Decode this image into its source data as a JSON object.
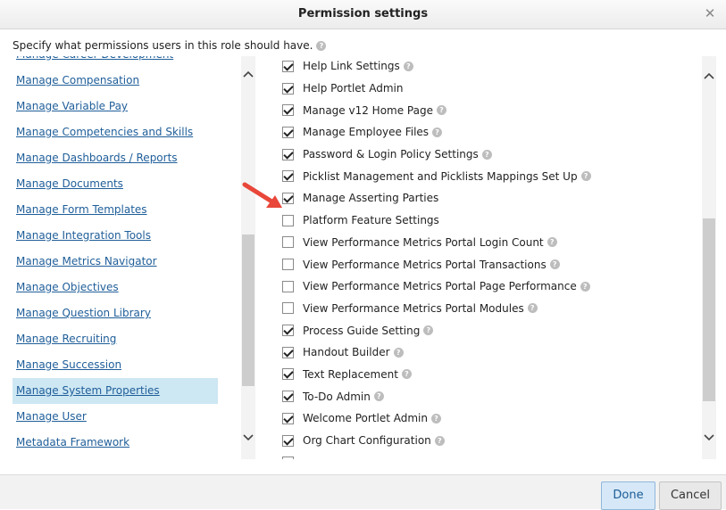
{
  "dialog": {
    "title": "Permission settings",
    "close_glyph": "✕",
    "instruction": "Specify what permissions users in this role should have.",
    "help_glyph": "?"
  },
  "left_list": {
    "items": [
      {
        "label": "Manage Career Development",
        "selected": false
      },
      {
        "label": "Manage Compensation",
        "selected": false
      },
      {
        "label": "Manage Variable Pay",
        "selected": false
      },
      {
        "label": "Manage Competencies and Skills",
        "selected": false
      },
      {
        "label": "Manage Dashboards / Reports",
        "selected": false
      },
      {
        "label": "Manage Documents",
        "selected": false
      },
      {
        "label": "Manage Form Templates",
        "selected": false
      },
      {
        "label": "Manage Integration Tools",
        "selected": false
      },
      {
        "label": "Manage Metrics Navigator",
        "selected": false
      },
      {
        "label": "Manage Objectives",
        "selected": false
      },
      {
        "label": "Manage Question Library",
        "selected": false
      },
      {
        "label": "Manage Recruiting",
        "selected": false
      },
      {
        "label": "Manage Succession",
        "selected": false
      },
      {
        "label": "Manage System Properties",
        "selected": true
      },
      {
        "label": "Manage User",
        "selected": false
      },
      {
        "label": "Metadata Framework",
        "selected": false
      }
    ]
  },
  "permissions": {
    "items": [
      {
        "label": "Help Link Settings",
        "checked": true,
        "help": true
      },
      {
        "label": "Help Portlet Admin",
        "checked": true,
        "help": false
      },
      {
        "label": "Manage v12 Home Page",
        "checked": true,
        "help": true
      },
      {
        "label": "Manage Employee Files",
        "checked": true,
        "help": true
      },
      {
        "label": "Password & Login Policy Settings",
        "checked": true,
        "help": true
      },
      {
        "label": "Picklist Management and Picklists Mappings Set Up",
        "checked": true,
        "help": true
      },
      {
        "label": "Manage Asserting Parties",
        "checked": true,
        "help": false
      },
      {
        "label": "Platform Feature Settings",
        "checked": false,
        "help": false
      },
      {
        "label": "View Performance Metrics Portal Login Count",
        "checked": false,
        "help": true
      },
      {
        "label": "View Performance Metrics Portal Transactions",
        "checked": false,
        "help": true
      },
      {
        "label": "View Performance Metrics Portal Page Performance",
        "checked": false,
        "help": true
      },
      {
        "label": "View Performance Metrics Portal Modules",
        "checked": false,
        "help": true
      },
      {
        "label": "Process Guide Setting",
        "checked": true,
        "help": true
      },
      {
        "label": "Handout Builder",
        "checked": true,
        "help": true
      },
      {
        "label": "Text Replacement",
        "checked": true,
        "help": true
      },
      {
        "label": "To-Do Admin",
        "checked": true,
        "help": true
      },
      {
        "label": "Welcome Portlet Admin",
        "checked": true,
        "help": true
      },
      {
        "label": "Org Chart Configuration",
        "checked": true,
        "help": true
      },
      {
        "label": "",
        "checked": false,
        "help": false
      }
    ]
  },
  "annotation": {
    "color": "#e8473a"
  },
  "scroll": {
    "left_thumb_fraction": 0.4,
    "right_thumb_fraction": 0.5
  },
  "footer": {
    "done_label": "Done",
    "cancel_label": "Cancel"
  },
  "icons": {
    "scroll_up": "chevron-up-icon",
    "scroll_down": "chevron-down-icon",
    "help": "help-circle-icon",
    "close": "close-icon"
  }
}
